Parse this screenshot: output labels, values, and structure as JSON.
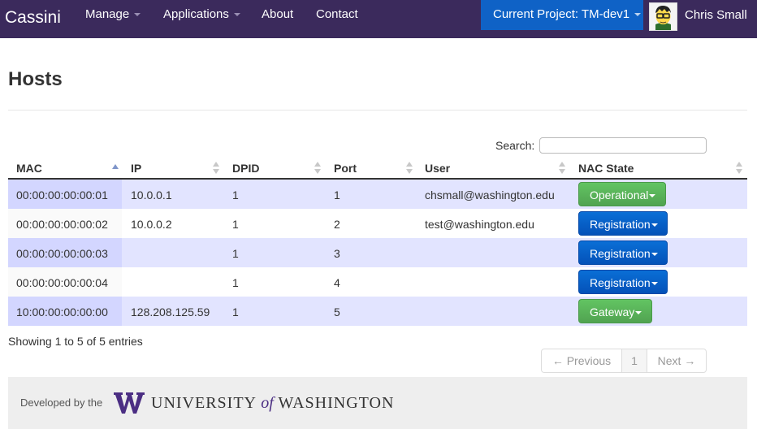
{
  "navbar": {
    "brand": "Cassini",
    "items": [
      {
        "label": "Manage",
        "dropdown": true
      },
      {
        "label": "Applications",
        "dropdown": true
      },
      {
        "label": "About",
        "dropdown": false
      },
      {
        "label": "Contact",
        "dropdown": false
      }
    ],
    "project": "Current Project: TM-dev1",
    "user": "Chris Small"
  },
  "page": {
    "title": "Hosts"
  },
  "search": {
    "label": "Search:",
    "value": ""
  },
  "table": {
    "columns": [
      "MAC",
      "IP",
      "DPID",
      "Port",
      "User",
      "NAC State"
    ],
    "sorted_column": "MAC",
    "rows": [
      {
        "mac": "00:00:00:00:00:01",
        "ip": "10.0.0.1",
        "dpid": "1",
        "port": "1",
        "user": "chsmall@washington.edu",
        "state": "Operational"
      },
      {
        "mac": "00:00:00:00:00:02",
        "ip": "10.0.0.2",
        "dpid": "1",
        "port": "2",
        "user": "test@washington.edu",
        "state": "Registration"
      },
      {
        "mac": "00:00:00:00:00:03",
        "ip": "",
        "dpid": "1",
        "port": "3",
        "user": "",
        "state": "Registration"
      },
      {
        "mac": "00:00:00:00:00:04",
        "ip": "",
        "dpid": "1",
        "port": "4",
        "user": "",
        "state": "Registration"
      },
      {
        "mac": "10:00:00:00:00:00",
        "ip": "128.208.125.59",
        "dpid": "1",
        "port": "5",
        "user": "",
        "state": "Gateway"
      }
    ]
  },
  "info": "Showing 1 to 5 of 5 entries",
  "pagination": {
    "previous": "← Previous",
    "page": "1",
    "next": "Next →"
  },
  "footer": {
    "developed_by": "Developed by the",
    "university_part1": "UNIVERSITY",
    "university_of": "of",
    "university_part2": "WASHINGTON"
  },
  "colors": {
    "navbar": "#3b2a5c",
    "project": "#0f62c6",
    "green": "#51a351",
    "blue": "#0451b8",
    "uw_purple": "#4b2e83"
  }
}
